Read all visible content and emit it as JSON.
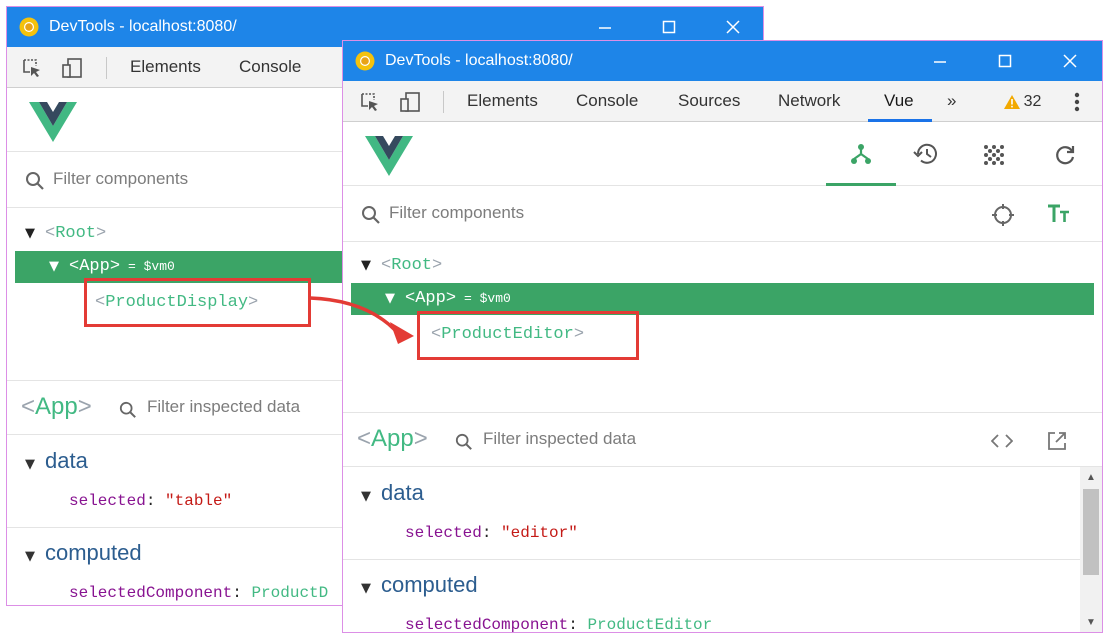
{
  "window_back": {
    "title": "DevTools - localhost:8080/",
    "tabs": [
      "Elements",
      "Console"
    ],
    "filter_placeholder": "Filter components",
    "tree": {
      "root": "Root",
      "app": "App",
      "app_ref": "= $vm0",
      "child": "ProductDisplay"
    },
    "inspector": {
      "component": "App",
      "filter_placeholder": "Filter inspected data",
      "data_title": "data",
      "data_key": "selected",
      "data_value": "\"table\"",
      "computed_title": "computed",
      "computed_key": "selectedComponent",
      "computed_value": "ProductD"
    }
  },
  "window_front": {
    "title": "DevTools - localhost:8080/",
    "tabs": [
      "Elements",
      "Console",
      "Sources",
      "Network",
      "Vue"
    ],
    "active_tab": "Vue",
    "overflow_tabs": "»",
    "warnings_count": "32",
    "filter_placeholder": "Filter components",
    "tree": {
      "root": "Root",
      "app": "App",
      "app_ref": "= $vm0",
      "child": "ProductEditor"
    },
    "inspector": {
      "component": "App",
      "filter_placeholder": "Filter inspected data",
      "data_title": "data",
      "data_key": "selected",
      "data_value": "\"editor\"",
      "computed_title": "computed",
      "computed_key": "selectedComponent",
      "computed_value": "ProductEditor"
    }
  },
  "colors": {
    "titlebar": "#1e85e8",
    "vue_green": "#42b983",
    "selected_row": "#3ba466",
    "highlight_red": "#e33b35",
    "window_border": "#dc8fe6"
  },
  "icons": [
    "chrome-icon",
    "minimize-icon",
    "maximize-icon",
    "close-icon",
    "inspect-element-icon",
    "device-toolbar-icon",
    "warning-icon",
    "kebab-menu-icon",
    "vue-logo",
    "components-tab-icon",
    "history-icon",
    "vuex-icon",
    "refresh-icon",
    "search-icon",
    "target-icon",
    "format-text-icon",
    "code-icon",
    "open-external-icon"
  ]
}
